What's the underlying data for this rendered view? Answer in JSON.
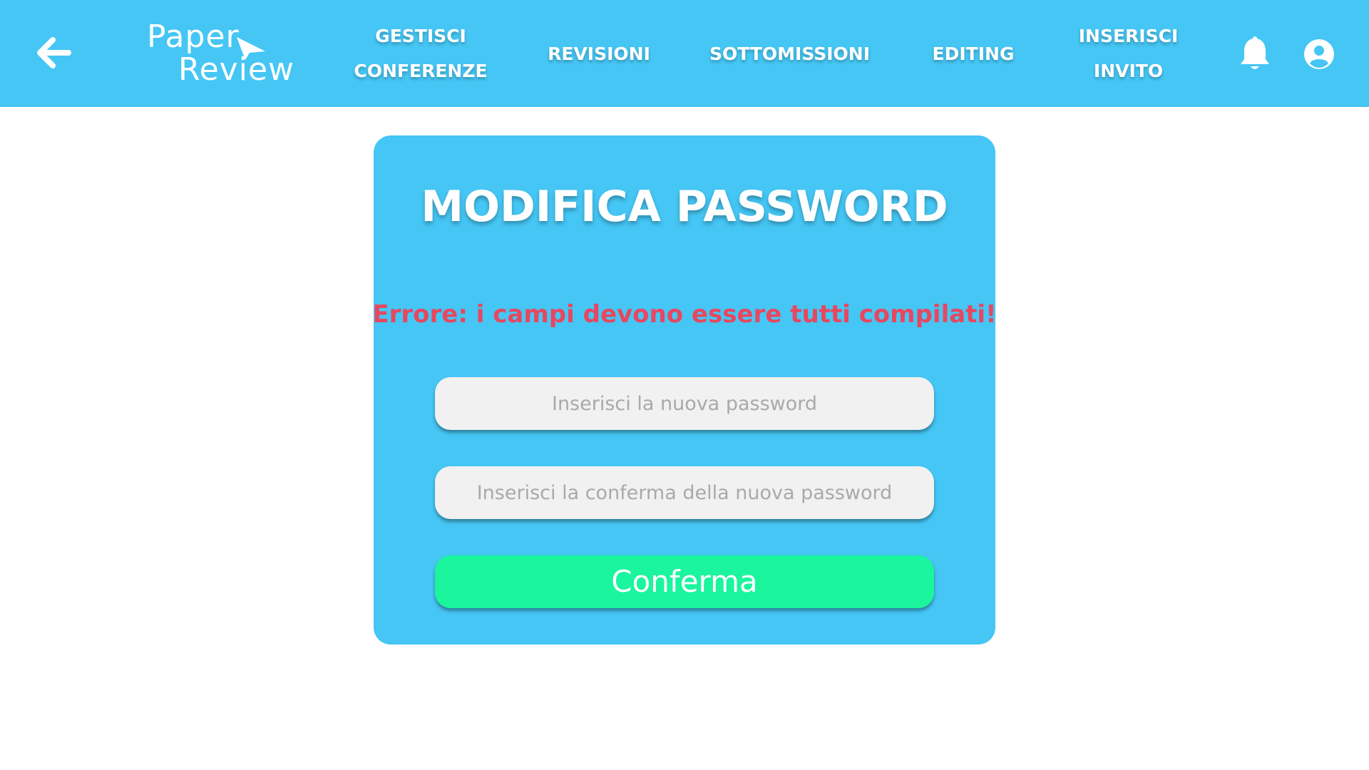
{
  "header": {
    "logo": {
      "line1": "Paper",
      "line2": "Review"
    },
    "nav": {
      "gestisci_conferenze": "GESTISCI\nCONFERENZE",
      "revisioni": "REVISIONI",
      "sottomissioni": "SOTTOMISSIONI",
      "editing": "EDITING",
      "inserisci_invito": "INSERISCI\nINVITO"
    },
    "icons": {
      "back": "arrow-left-icon",
      "logo_mark": "paper-plane-icon",
      "notifications": "bell-icon",
      "profile": "user-circle-icon"
    }
  },
  "form": {
    "title": "MODIFICA PASSWORD",
    "error": "Errore: i campi devono essere tutti compilati!",
    "new_password": {
      "value": "",
      "placeholder": "Inserisci la nuova password"
    },
    "confirm_password": {
      "value": "",
      "placeholder": "Inserisci la conferma della nuova password"
    },
    "submit_label": "Conferma"
  },
  "colors": {
    "primary": "#45c6f4",
    "error": "#e8475f",
    "confirm": "#1af59e",
    "field_bg": "#f1f1f1",
    "text_on_primary": "#ffffff"
  }
}
